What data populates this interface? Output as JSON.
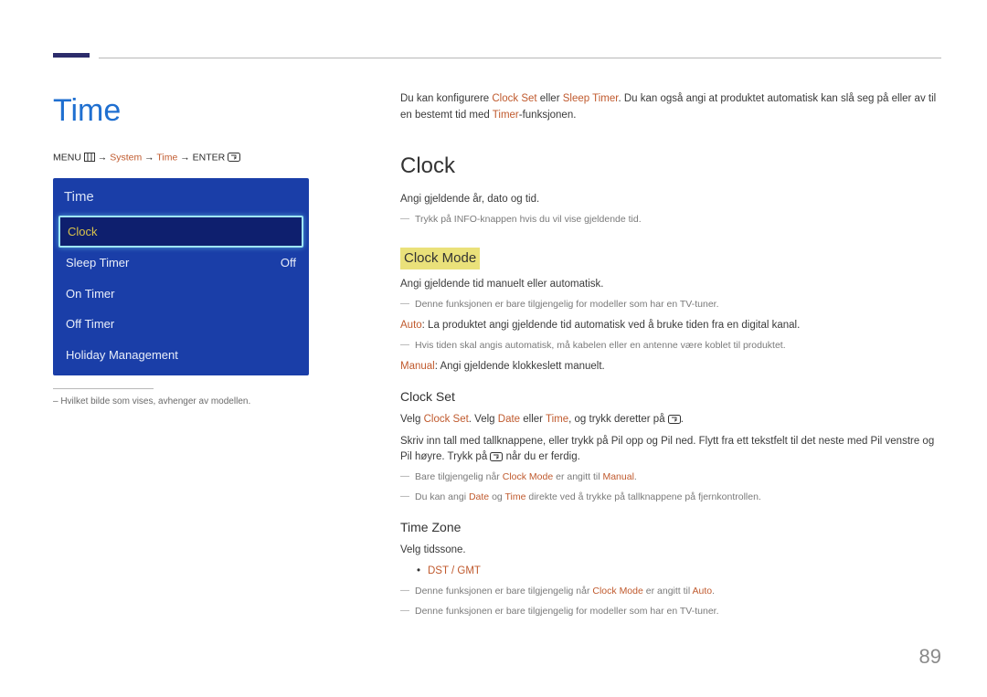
{
  "page": {
    "title": "Time",
    "menu_path": {
      "prefix": "MENU",
      "sep": " → ",
      "system": "System",
      "time": "Time",
      "enter": "ENTER"
    },
    "panel": {
      "title": "Time",
      "rows": [
        {
          "label": "Clock",
          "value": "",
          "selected": true
        },
        {
          "label": "Sleep Timer",
          "value": "Off"
        },
        {
          "label": "On Timer",
          "value": ""
        },
        {
          "label": "Off Timer",
          "value": ""
        },
        {
          "label": "Holiday Management",
          "value": ""
        }
      ]
    },
    "caption": "–  Hvilket bilde som vises, avhenger av modellen."
  },
  "right": {
    "intro": {
      "t1": "Du kan konfigurere ",
      "a1": "Clock Set",
      "t2": " eller ",
      "a2": "Sleep Timer",
      "t3": ". Du kan også angi at produktet automatisk kan slå seg på eller av til en bestemt tid med ",
      "a3": "Timer",
      "t4": "-funksjonen."
    },
    "clock": {
      "heading": "Clock",
      "p1": "Angi gjeldende år, dato og tid.",
      "note1": "Trykk på INFO-knappen hvis du vil vise gjeldende tid."
    },
    "clock_mode": {
      "heading": "Clock Mode",
      "p1": "Angi gjeldende tid manuelt eller automatisk.",
      "note1": "Denne funksjonen er bare tilgjengelig for modeller som har en TV-tuner.",
      "auto_label": "Auto",
      "auto_text": ": La produktet angi gjeldende tid automatisk ved å bruke tiden fra en digital kanal.",
      "note2": "Hvis tiden skal angis automatisk, må kabelen eller en antenne være koblet til produktet.",
      "manual_label": "Manual",
      "manual_text": ": Angi gjeldende klokkeslett manuelt."
    },
    "clock_set": {
      "heading": "Clock Set",
      "l1_a": "Velg ",
      "l1_b": "Clock Set",
      "l1_c": ". Velg ",
      "l1_d": "Date",
      "l1_e": " eller ",
      "l1_f": "Time",
      "l1_g": ", og trykk deretter på ",
      "l1_h": ".",
      "p2a": "Skriv inn tall med tallknappene, eller trykk på Pil opp og Pil ned. Flytt fra ett tekstfelt til det neste med Pil venstre og Pil høyre. Trykk på ",
      "p2b": " når du er ferdig.",
      "note1_a": "Bare tilgjengelig når ",
      "note1_b": "Clock Mode",
      "note1_c": " er angitt til ",
      "note1_d": "Manual",
      "note1_e": ".",
      "note2_a": "Du kan angi ",
      "note2_b": "Date",
      "note2_c": " og ",
      "note2_d": "Time",
      "note2_e": " direkte ved å trykke på tallknappene på fjernkontrollen."
    },
    "time_zone": {
      "heading": "Time Zone",
      "p1": "Velg tidssone.",
      "bullet": "DST / GMT",
      "note1_a": "Denne funksjonen er bare tilgjengelig når ",
      "note1_b": "Clock Mode",
      "note1_c": " er angitt til ",
      "note1_d": "Auto",
      "note1_e": ".",
      "note2": "Denne funksjonen er bare tilgjengelig for modeller som har en TV-tuner."
    }
  },
  "page_number": "89"
}
